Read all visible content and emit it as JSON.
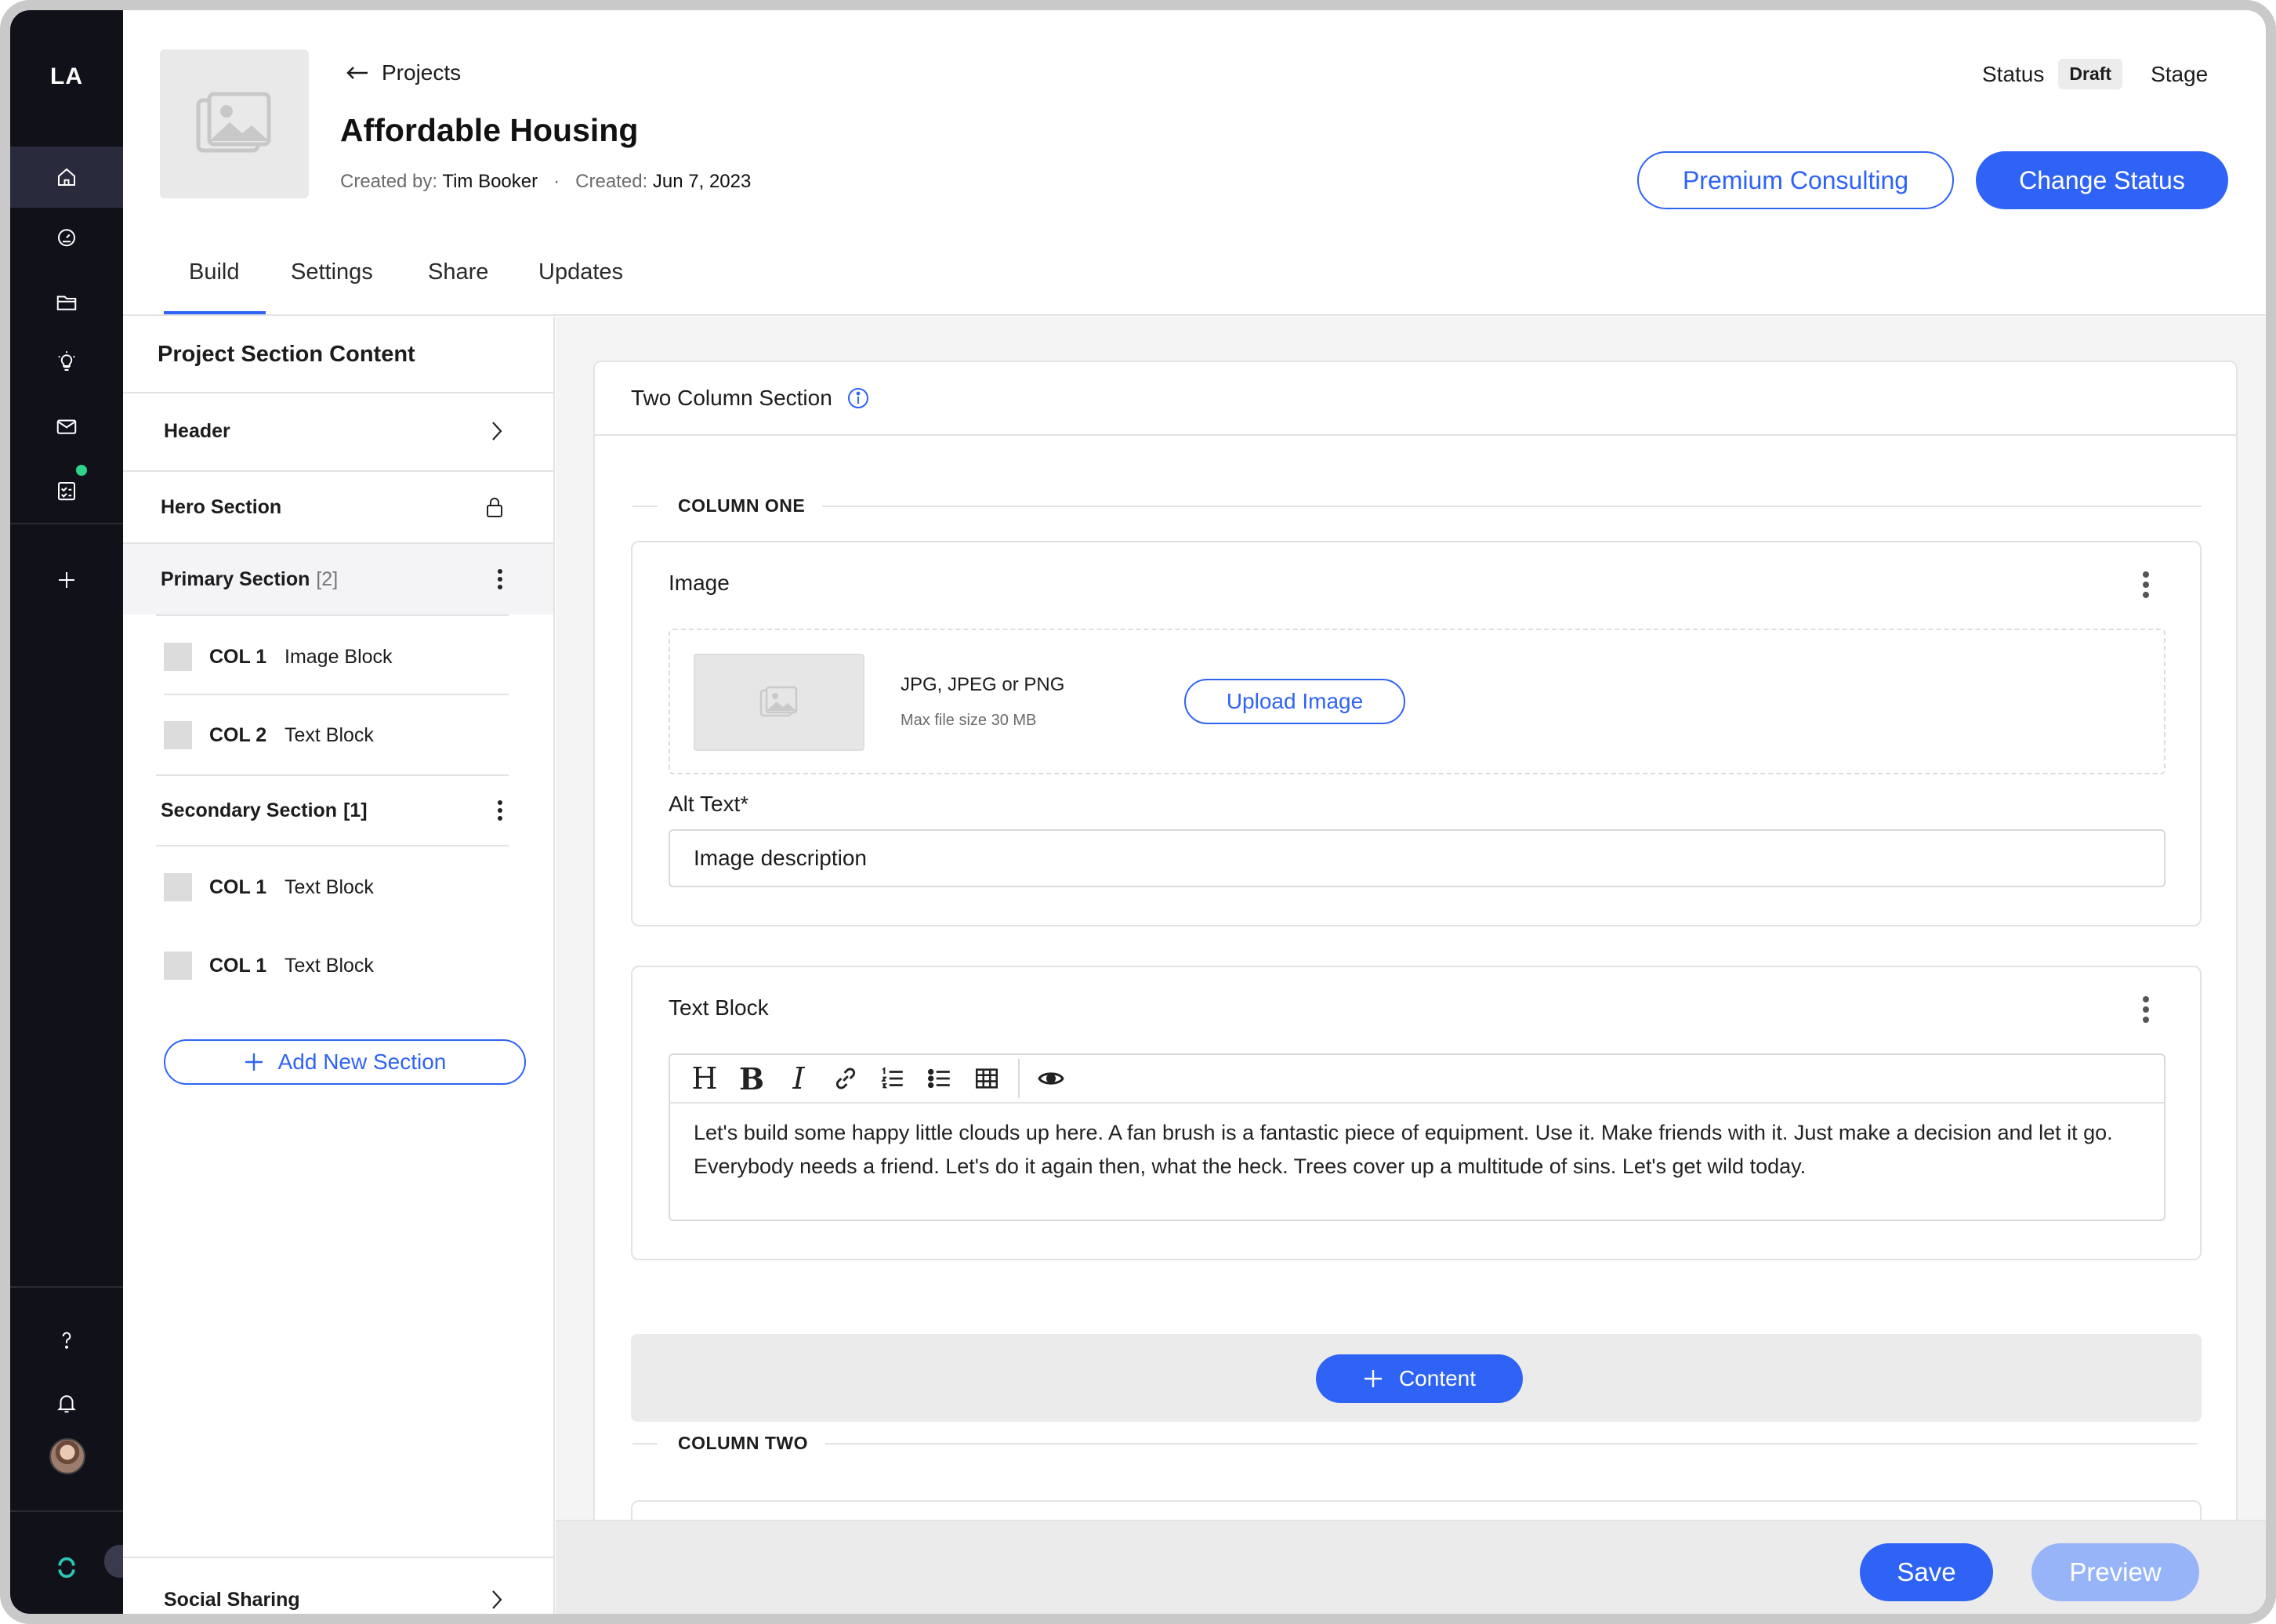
{
  "app": {
    "logo": "LA"
  },
  "rail": {
    "icons": [
      "home-icon",
      "gauge-icon",
      "folder-icon",
      "lightbulb-icon",
      "mail-icon",
      "checklist-icon",
      "plus-icon",
      "help-icon",
      "bell-icon",
      "avatar",
      "brand-icon"
    ]
  },
  "header": {
    "back_label": "Projects",
    "title": "Affordable Housing",
    "created_by_label": "Created by:",
    "created_by": "Tim Booker",
    "separator": "·",
    "created_label": "Created:",
    "created_date": "Jun 7, 2023",
    "status_label": "Status",
    "status_value": "Draft",
    "stage_label": "Stage",
    "premium_button": "Premium Consulting",
    "change_status_button": "Change Status"
  },
  "tabs": [
    {
      "label": "Build",
      "active": true
    },
    {
      "label": "Settings"
    },
    {
      "label": "Share"
    },
    {
      "label": "Updates"
    }
  ],
  "sidebar": {
    "title": "Project Section Content",
    "header_item": "Header",
    "hero_item": "Hero Section",
    "primary": {
      "label": "Primary Section",
      "count": "[2]"
    },
    "primary_items": [
      {
        "col": "COL 1",
        "type": "Image Block"
      },
      {
        "col": "COL 2",
        "type": "Text Block"
      }
    ],
    "secondary": {
      "label": "Secondary Section",
      "count": "[1]"
    },
    "secondary_items": [
      {
        "col": "COL 1",
        "type": "Text Block"
      },
      {
        "col": "COL 1",
        "type": "Text Block"
      }
    ],
    "add_section": "Add New Section",
    "social_sharing": "Social Sharing"
  },
  "main": {
    "section_title": "Two Column Section",
    "column_one": "COLUMN ONE",
    "column_two": "COLUMN TWO",
    "image_block": {
      "title": "Image",
      "types": "JPG, JPEG or PNG",
      "max_size": "Max file size 30 MB",
      "upload_button": "Upload Image",
      "alt_label": "Alt Text*",
      "alt_value": "Image description"
    },
    "text_block": {
      "title": "Text Block",
      "toolbar": [
        "H",
        "B",
        "I",
        "link-icon",
        "ordered-list-icon",
        "bullet-list-icon",
        "table-icon",
        "eye-icon"
      ],
      "content": "Let's build some happy little clouds up here. A fan brush is a fantastic piece of equipment. Use it. Make friends with it. Just make a decision and let it go. Everybody needs a friend. Let's do it again then, what the heck. Trees cover up a multitude of sins. Let's get wild today."
    },
    "add_content_button": "Content"
  },
  "footer": {
    "save": "Save",
    "preview": "Preview"
  },
  "colors": {
    "accent": "#2f63f5",
    "rail_bg": "#11111a",
    "preview_disabled": "#98b4f9",
    "notification_dot": "#2fd48a"
  }
}
